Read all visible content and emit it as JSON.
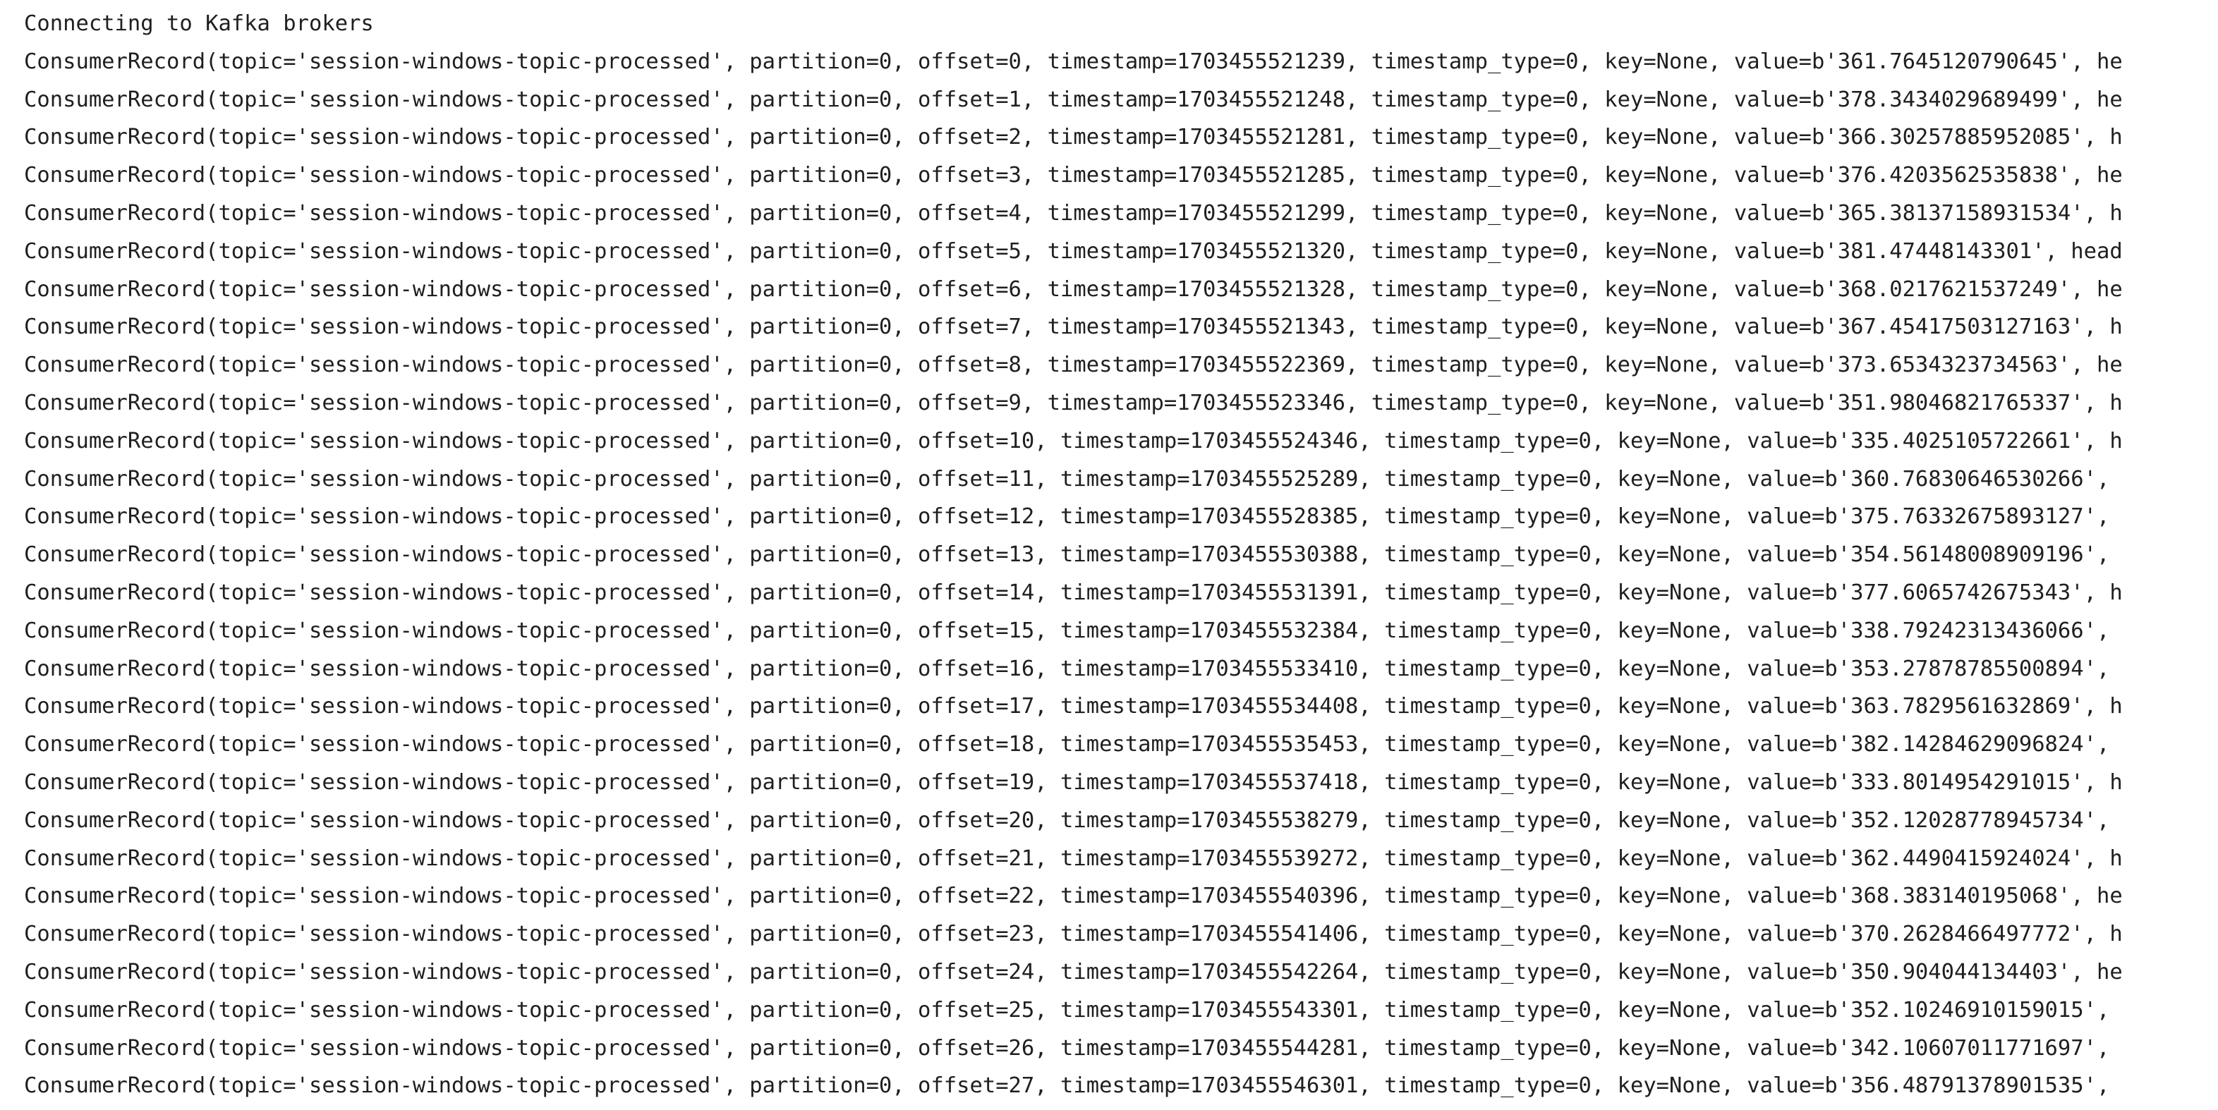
{
  "console": {
    "header": "Connecting to Kafka brokers",
    "lines": [
      "ConsumerRecord(topic='session-windows-topic-processed', partition=0, offset=0, timestamp=1703455521239, timestamp_type=0, key=None, value=b'361.7645120790645', he",
      "ConsumerRecord(topic='session-windows-topic-processed', partition=0, offset=1, timestamp=1703455521248, timestamp_type=0, key=None, value=b'378.3434029689499', he",
      "ConsumerRecord(topic='session-windows-topic-processed', partition=0, offset=2, timestamp=1703455521281, timestamp_type=0, key=None, value=b'366.30257885952085', h",
      "ConsumerRecord(topic='session-windows-topic-processed', partition=0, offset=3, timestamp=1703455521285, timestamp_type=0, key=None, value=b'376.4203562535838', he",
      "ConsumerRecord(topic='session-windows-topic-processed', partition=0, offset=4, timestamp=1703455521299, timestamp_type=0, key=None, value=b'365.38137158931534', h",
      "ConsumerRecord(topic='session-windows-topic-processed', partition=0, offset=5, timestamp=1703455521320, timestamp_type=0, key=None, value=b'381.47448143301', head",
      "ConsumerRecord(topic='session-windows-topic-processed', partition=0, offset=6, timestamp=1703455521328, timestamp_type=0, key=None, value=b'368.0217621537249', he",
      "ConsumerRecord(topic='session-windows-topic-processed', partition=0, offset=7, timestamp=1703455521343, timestamp_type=0, key=None, value=b'367.45417503127163', h",
      "ConsumerRecord(topic='session-windows-topic-processed', partition=0, offset=8, timestamp=1703455522369, timestamp_type=0, key=None, value=b'373.6534323734563', he",
      "ConsumerRecord(topic='session-windows-topic-processed', partition=0, offset=9, timestamp=1703455523346, timestamp_type=0, key=None, value=b'351.98046821765337', h",
      "ConsumerRecord(topic='session-windows-topic-processed', partition=0, offset=10, timestamp=1703455524346, timestamp_type=0, key=None, value=b'335.4025105722661', h",
      "ConsumerRecord(topic='session-windows-topic-processed', partition=0, offset=11, timestamp=1703455525289, timestamp_type=0, key=None, value=b'360.76830646530266',",
      "ConsumerRecord(topic='session-windows-topic-processed', partition=0, offset=12, timestamp=1703455528385, timestamp_type=0, key=None, value=b'375.76332675893127',",
      "ConsumerRecord(topic='session-windows-topic-processed', partition=0, offset=13, timestamp=1703455530388, timestamp_type=0, key=None, value=b'354.56148008909196',",
      "ConsumerRecord(topic='session-windows-topic-processed', partition=0, offset=14, timestamp=1703455531391, timestamp_type=0, key=None, value=b'377.6065742675343', h",
      "ConsumerRecord(topic='session-windows-topic-processed', partition=0, offset=15, timestamp=1703455532384, timestamp_type=0, key=None, value=b'338.79242313436066',",
      "ConsumerRecord(topic='session-windows-topic-processed', partition=0, offset=16, timestamp=1703455533410, timestamp_type=0, key=None, value=b'353.27878785500894',",
      "ConsumerRecord(topic='session-windows-topic-processed', partition=0, offset=17, timestamp=1703455534408, timestamp_type=0, key=None, value=b'363.7829561632869', h",
      "ConsumerRecord(topic='session-windows-topic-processed', partition=0, offset=18, timestamp=1703455535453, timestamp_type=0, key=None, value=b'382.14284629096824',",
      "ConsumerRecord(topic='session-windows-topic-processed', partition=0, offset=19, timestamp=1703455537418, timestamp_type=0, key=None, value=b'333.8014954291015', h",
      "ConsumerRecord(topic='session-windows-topic-processed', partition=0, offset=20, timestamp=1703455538279, timestamp_type=0, key=None, value=b'352.12028778945734',",
      "ConsumerRecord(topic='session-windows-topic-processed', partition=0, offset=21, timestamp=1703455539272, timestamp_type=0, key=None, value=b'362.4490415924024', h",
      "ConsumerRecord(topic='session-windows-topic-processed', partition=0, offset=22, timestamp=1703455540396, timestamp_type=0, key=None, value=b'368.383140195068', he",
      "ConsumerRecord(topic='session-windows-topic-processed', partition=0, offset=23, timestamp=1703455541406, timestamp_type=0, key=None, value=b'370.2628466497772', h",
      "ConsumerRecord(topic='session-windows-topic-processed', partition=0, offset=24, timestamp=1703455542264, timestamp_type=0, key=None, value=b'350.904044134403', he",
      "ConsumerRecord(topic='session-windows-topic-processed', partition=0, offset=25, timestamp=1703455543301, timestamp_type=0, key=None, value=b'352.10246910159015',",
      "ConsumerRecord(topic='session-windows-topic-processed', partition=0, offset=26, timestamp=1703455544281, timestamp_type=0, key=None, value=b'342.10607011771697',",
      "ConsumerRecord(topic='session-windows-topic-processed', partition=0, offset=27, timestamp=1703455546301, timestamp_type=0, key=None, value=b'356.48791378901535',"
    ]
  }
}
